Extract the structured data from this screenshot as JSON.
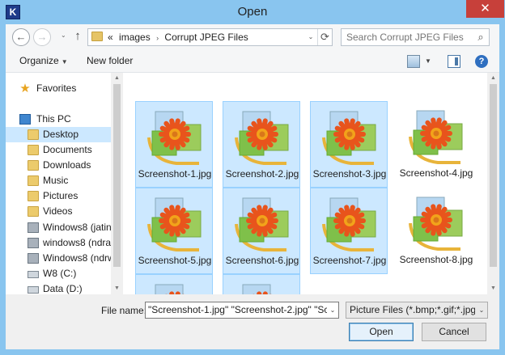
{
  "window": {
    "title": "Open",
    "app_icon_letter": "K",
    "close_glyph": "✕"
  },
  "address_bar": {
    "back_glyph": "←",
    "forward_glyph": "→",
    "up_glyph": "↑",
    "overflow": "«",
    "breadcrumbs": [
      "images",
      "Corrupt JPEG Files"
    ],
    "separator": "›",
    "dropdown_glyph": "⌄",
    "refresh_glyph": "⟳"
  },
  "search": {
    "placeholder": "Search Corrupt JPEG Files",
    "icon": "search-icon"
  },
  "toolbar": {
    "organize": "Organize",
    "new_folder": "New folder",
    "help_glyph": "?"
  },
  "navigation": {
    "favorites": "Favorites",
    "this_pc": "This PC",
    "items": [
      {
        "label": "Desktop",
        "icon": "folder-icon",
        "selected": true
      },
      {
        "label": "Documents",
        "icon": "folder-icon",
        "selected": false
      },
      {
        "label": "Downloads",
        "icon": "folder-icon",
        "selected": false
      },
      {
        "label": "Music",
        "icon": "folder-icon",
        "selected": false
      },
      {
        "label": "Pictures",
        "icon": "folder-icon",
        "selected": false
      },
      {
        "label": "Videos",
        "icon": "folder-icon",
        "selected": false
      },
      {
        "label": "Windows8 (jatin-",
        "icon": "network-drive-icon",
        "selected": false
      },
      {
        "label": "windows8 (ndra3",
        "icon": "network-drive-icon",
        "selected": false
      },
      {
        "label": "Windows8 (ndrw",
        "icon": "network-drive-icon",
        "selected": false
      },
      {
        "label": "W8 (C:)",
        "icon": "drive-icon",
        "selected": false
      },
      {
        "label": "Data (D:)",
        "icon": "drive-icon",
        "selected": false
      }
    ]
  },
  "files": [
    {
      "name": "Screenshot-1.jpg",
      "selected": true
    },
    {
      "name": "Screenshot-2.jpg",
      "selected": true
    },
    {
      "name": "Screenshot-3.jpg",
      "selected": true
    },
    {
      "name": "Screenshot-4.jpg",
      "selected": false
    },
    {
      "name": "Screenshot-5.jpg",
      "selected": true
    },
    {
      "name": "Screenshot-6.jpg",
      "selected": true
    },
    {
      "name": "Screenshot-7.jpg",
      "selected": true
    },
    {
      "name": "Screenshot-8.jpg",
      "selected": false
    },
    {
      "name": "",
      "selected": true
    },
    {
      "name": "",
      "selected": true
    }
  ],
  "bottom": {
    "file_name_label": "File name:",
    "file_name_value": "\"Screenshot-1.jpg\" \"Screenshot-2.jpg\" \"Scree",
    "file_type": "Picture Files (*.bmp;*.gif;*.jpg;*",
    "open": "Open",
    "cancel": "Cancel"
  },
  "colors": {
    "frame": "#89c5ef",
    "selection": "#cce8ff",
    "close_button": "#c7403a"
  }
}
